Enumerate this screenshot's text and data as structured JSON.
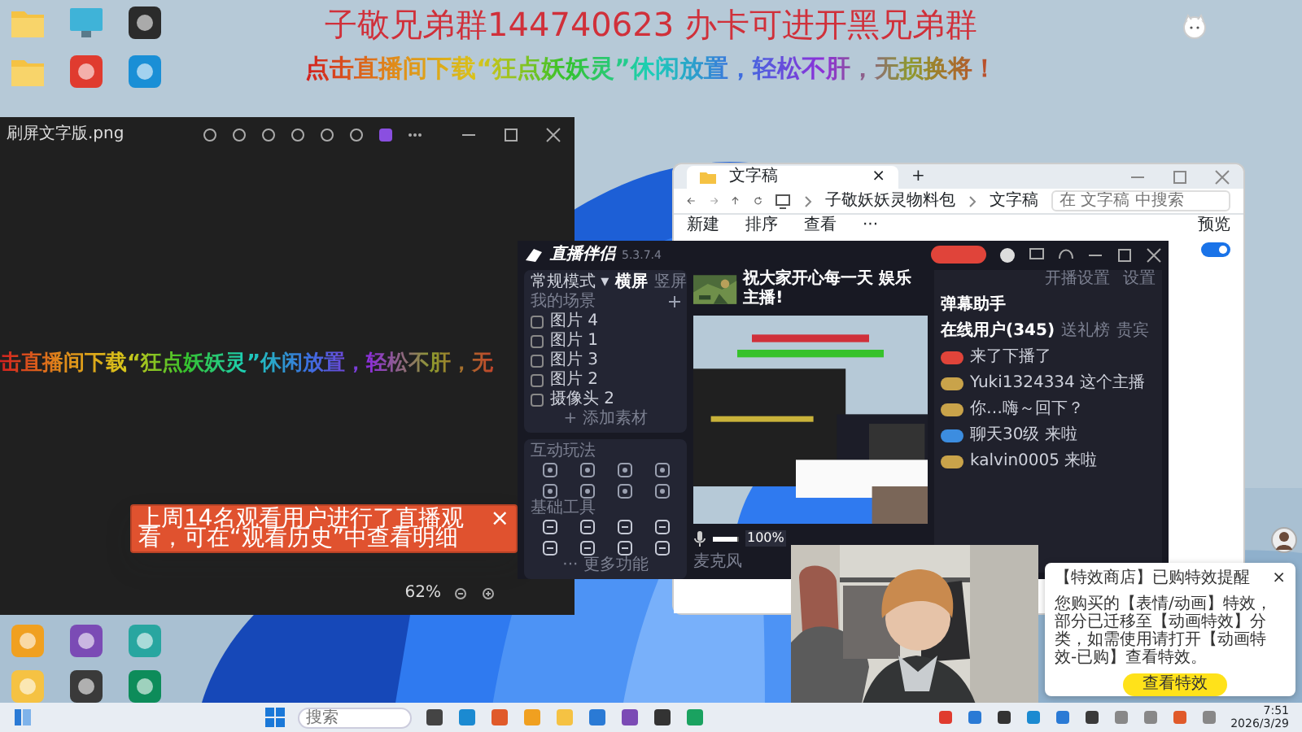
{
  "banner": {
    "line_1": "子敬兄弟群144740623 办卡可进开黑兄弟群",
    "line_2": "点击直播间下载“狂点妖妖灵”休闲放置，轻松不肝，无损换将！"
  },
  "desktop_icons": [
    {
      "kind": "folder"
    },
    {
      "kind": "monitor"
    },
    {
      "kind": "app"
    },
    {
      "kind": "folder"
    },
    {
      "kind": "app"
    },
    {
      "kind": "app"
    },
    {
      "kind": "app"
    },
    {
      "kind": "app"
    },
    {
      "kind": "app"
    },
    {
      "kind": "app"
    },
    {
      "kind": "app"
    },
    {
      "kind": "app"
    }
  ],
  "photo_viewer": {
    "title": "刷屏文字版.png",
    "image_text": "击直播间下载“狂点妖妖灵”休闲放置，轻松不肝，无",
    "zoom": "62%"
  },
  "toast": {
    "text": "上周14名观看用户进行了直播观看，可在“观看历史”中查看明细",
    "close": "×"
  },
  "explorer": {
    "tab": "文字稿",
    "tab_close": "×",
    "new_tab": "+",
    "path": [
      "子敬妖妖灵物料包",
      "文字稿"
    ],
    "search": {
      "placeholder": "在 文字稿 中搜索"
    },
    "toolbar": [
      "新建",
      "排序",
      "查看",
      "···"
    ],
    "preview": "预览",
    "toggle_on": true
  },
  "live_app": {
    "name": "直播伴侣",
    "version": "5.3.7.4",
    "mode": "常规模式 ▾",
    "orientations": [
      {
        "label": "横屏",
        "selected": true
      },
      {
        "label": "竖屏",
        "selected": false
      }
    ],
    "scenes_label": "我的场景",
    "scenes": [
      {
        "label": "图片 4",
        "checked": false
      },
      {
        "label": "图片 1",
        "checked": false
      },
      {
        "label": "图片 3",
        "checked": false
      },
      {
        "label": "图片 2",
        "checked": false
      },
      {
        "label": "摄像头 2",
        "checked": false
      }
    ],
    "add_source": "+ 添加素材",
    "interact_title": "互动玩法",
    "tools_title": "基础工具",
    "more": "··· 更多功能",
    "stream_title": "祝大家开心每一天 娱乐主播!",
    "mic": {
      "level": 0.95
    },
    "mic_reading": "100%",
    "mic_label": "麦克风",
    "header_links": [
      "开播设置",
      "设置"
    ],
    "danmu_title": "弹幕助手",
    "tabs": [
      {
        "label": "在线用户(345)",
        "selected": true
      },
      {
        "label": "送礼榜",
        "selected": false
      },
      {
        "label": "贵宾",
        "selected": false
      }
    ],
    "chat": [
      {
        "color": "#e0443a",
        "text": "来了下播了"
      },
      {
        "color": "#c9a34a",
        "text": "Yuki1324334 这个主播"
      },
      {
        "color": "#c9a34a",
        "text": "你…嗨～回下？"
      },
      {
        "color": "#3c8de0",
        "text": "聊天30级 来啦"
      },
      {
        "color": "#c9a34a",
        "text": "kalvin0005 来啦"
      }
    ]
  },
  "notification": {
    "title": "【特效商店】已购特效提醒",
    "close": "×",
    "body": "您购买的【表情/动画】特效，部分已迁移至【动画特效】分类，如需使用请打开【动画特效-已购】查看特效。",
    "button": "查看特效"
  },
  "taskbar": {
    "search": {
      "placeholder": "搜索"
    },
    "time": "7:51",
    "date": "2026/3/29"
  }
}
